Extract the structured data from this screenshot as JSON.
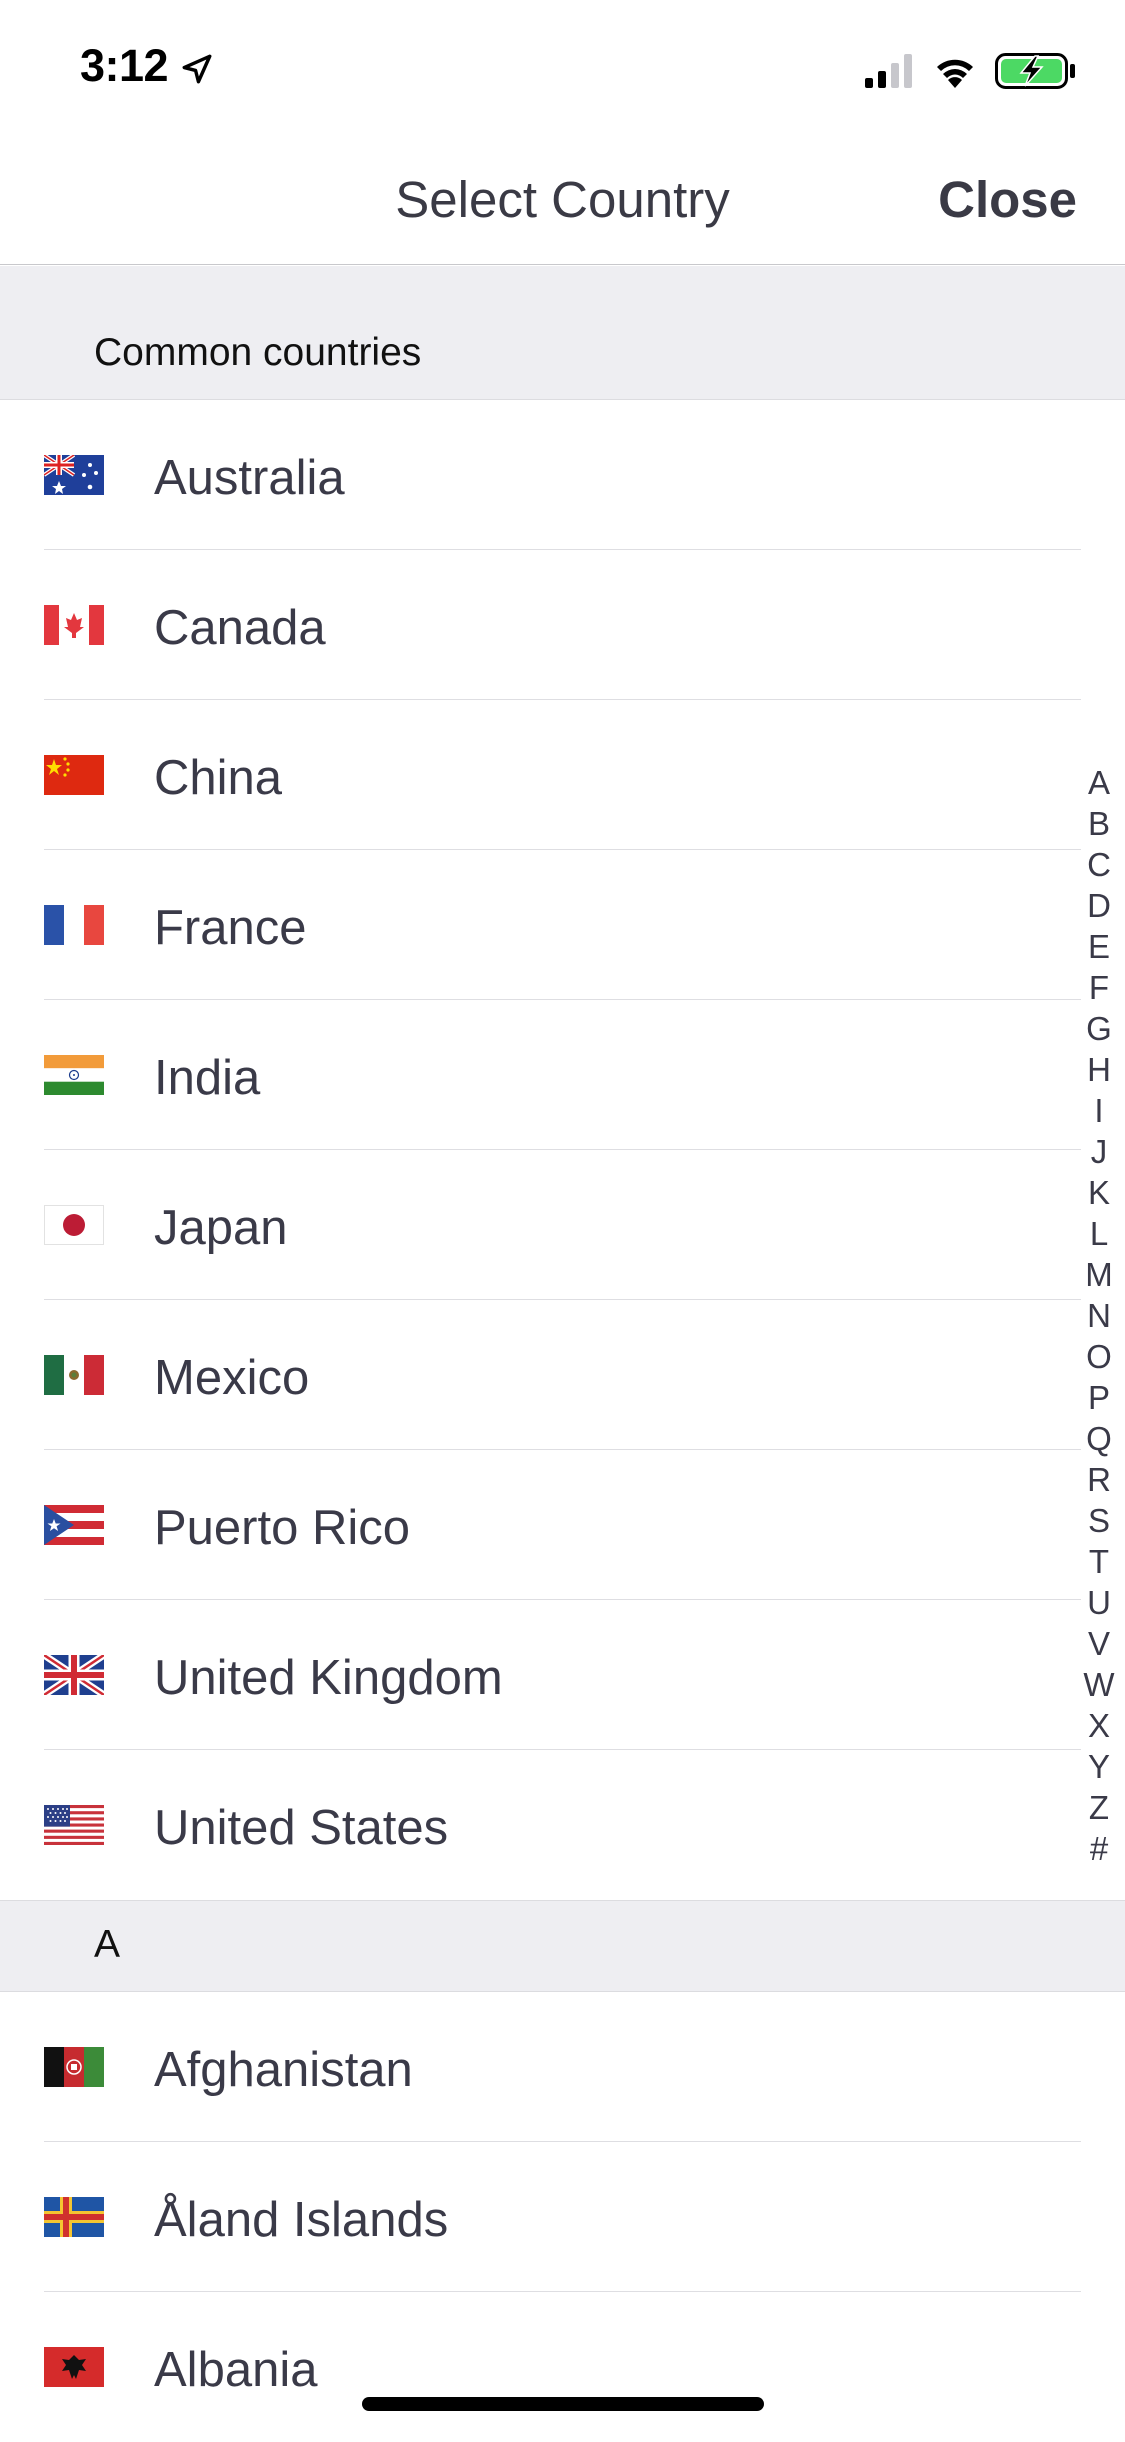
{
  "status_bar": {
    "time": "3:12",
    "location_icon": "location-arrow-icon",
    "signal_icon": "cellular-signal-icon",
    "wifi_icon": "wifi-icon",
    "battery_icon": "battery-charging-icon",
    "battery_color": "#4cd964"
  },
  "nav": {
    "title": "Select Country",
    "close_label": "Close"
  },
  "sections": {
    "common": {
      "header": "Common countries",
      "items": [
        {
          "name": "Australia",
          "flag": "australia-flag-icon"
        },
        {
          "name": "Canada",
          "flag": "canada-flag-icon"
        },
        {
          "name": "China",
          "flag": "china-flag-icon"
        },
        {
          "name": "France",
          "flag": "france-flag-icon"
        },
        {
          "name": "India",
          "flag": "india-flag-icon"
        },
        {
          "name": "Japan",
          "flag": "japan-flag-icon"
        },
        {
          "name": "Mexico",
          "flag": "mexico-flag-icon"
        },
        {
          "name": "Puerto Rico",
          "flag": "puerto-rico-flag-icon"
        },
        {
          "name": "United Kingdom",
          "flag": "united-kingdom-flag-icon"
        },
        {
          "name": "United States",
          "flag": "united-states-flag-icon"
        }
      ]
    },
    "a": {
      "header": "A",
      "items": [
        {
          "name": "Afghanistan",
          "flag": "afghanistan-flag-icon"
        },
        {
          "name": "Åland Islands",
          "flag": "aland-islands-flag-icon"
        },
        {
          "name": "Albania",
          "flag": "albania-flag-icon"
        }
      ]
    }
  },
  "index": [
    "A",
    "B",
    "C",
    "D",
    "E",
    "F",
    "G",
    "H",
    "I",
    "J",
    "K",
    "L",
    "M",
    "N",
    "O",
    "P",
    "Q",
    "R",
    "S",
    "T",
    "U",
    "V",
    "W",
    "X",
    "Y",
    "Z",
    "#"
  ]
}
